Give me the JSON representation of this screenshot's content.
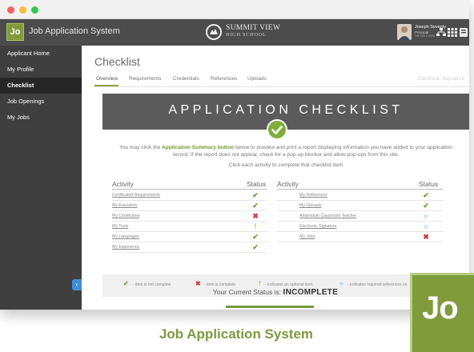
{
  "app": {
    "logo_text": "Jo",
    "title": "Job Application System",
    "school_name": "SUMMIT VIEW",
    "school_sub": "HIGH SCHOOL"
  },
  "user": {
    "name": "Joseph Seventy",
    "role": "Principal",
    "meta": "Job Title # 0000"
  },
  "sidebar": {
    "items": [
      {
        "label": "Applicant Home"
      },
      {
        "label": "My Profile"
      },
      {
        "label": "Checklist",
        "active": true
      },
      {
        "label": "Job Openings"
      },
      {
        "label": "My Jobs"
      }
    ],
    "collapse_glyph": "‹"
  },
  "main": {
    "page_title": "Checklist",
    "tabs": [
      {
        "label": "Overview",
        "active": true
      },
      {
        "label": "Requirements"
      },
      {
        "label": "Credentials"
      },
      {
        "label": "References"
      },
      {
        "label": "Uploads"
      },
      {
        "label": "Electronic Signature"
      }
    ]
  },
  "checklist": {
    "title": "APPLICATION CHECKLIST",
    "intro_before": "You may click the ",
    "intro_bold": "Application Summary button",
    "intro_after": " below to preview and print a report displaying information you have added to your application record. If the report does not appear, check for a pop-up blocker and allow pop-ups from this site.",
    "instruction": "Click each activity to complete that checklist item",
    "col_activity": "Activity",
    "col_status": "Status",
    "left_rows": [
      {
        "label": "Certificated Requirements",
        "status": "complete"
      },
      {
        "label": "My Education",
        "status": "complete"
      },
      {
        "label": "My Certificates",
        "status": "incomplete"
      },
      {
        "label": "My Tests",
        "status": "optional"
      },
      {
        "label": "My Languages",
        "status": "complete"
      },
      {
        "label": "My Experience",
        "status": "complete"
      }
    ],
    "right_rows": [
      {
        "label": "My References",
        "status": "complete"
      },
      {
        "label": "My Uploads",
        "status": "complete"
      },
      {
        "label": "Addendum Classroom Teacher",
        "status": "references"
      },
      {
        "label": "Electronic Signature",
        "status": "references"
      },
      {
        "label": "My Jobs",
        "status": "incomplete"
      }
    ],
    "legend": [
      {
        "status": "complete",
        "text": "- item is not complete"
      },
      {
        "status": "incomplete",
        "text": "- item is complete"
      },
      {
        "status": "optional",
        "text": "- indicates an optional item"
      },
      {
        "status": "references",
        "text": "- indicates required references ne"
      }
    ],
    "current_status_label": "Your Current Status is:",
    "current_status_value": "INCOMPLETE"
  },
  "footer": {
    "title": "Job Application System",
    "logo_text": "Jo"
  },
  "colors": {
    "complete": "#6c9f2f",
    "incomplete": "#d0393b",
    "optional": "#f0b400",
    "references": "#2f8ad6",
    "brand_green": "#7f9b3b"
  },
  "icons": {
    "complete": "✔",
    "incomplete": "✖",
    "optional": "!",
    "references": "○"
  }
}
